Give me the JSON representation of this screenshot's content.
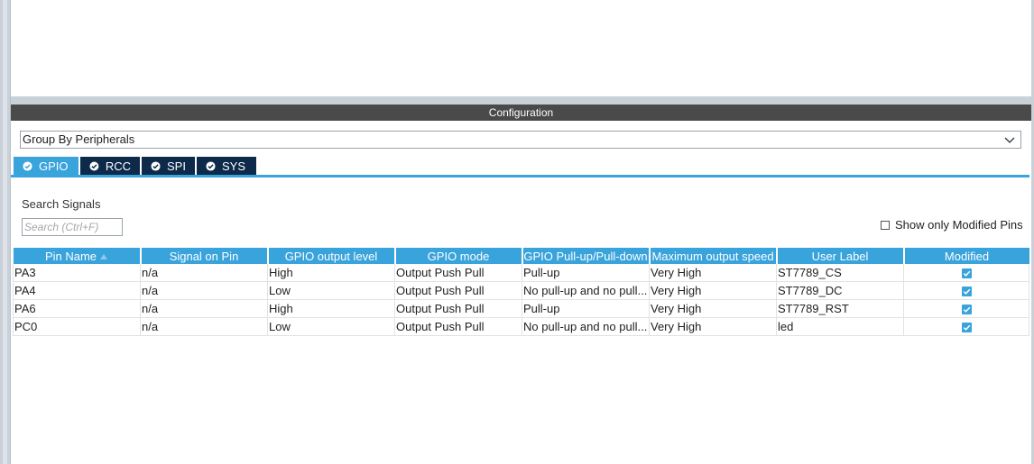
{
  "config_title": "Configuration",
  "group_by": {
    "selected": "Group By Peripherals"
  },
  "tabs": [
    {
      "label": "GPIO",
      "active": true
    },
    {
      "label": "RCC",
      "active": false
    },
    {
      "label": "SPI",
      "active": false
    },
    {
      "label": "SYS",
      "active": false
    }
  ],
  "search": {
    "label": "Search Signals",
    "placeholder": "Search (Ctrl+F)",
    "value": ""
  },
  "show_modified": {
    "label": "Show only Modified Pins",
    "checked": false
  },
  "table": {
    "columns": [
      "Pin Name",
      "Signal on Pin",
      "GPIO output level",
      "GPIO mode",
      "GPIO Pull-up/Pull-down",
      "Maximum output speed",
      "User Label",
      "Modified"
    ],
    "sorted_column": "Pin Name",
    "rows": [
      [
        "PA3",
        "n/a",
        "High",
        "Output Push Pull",
        "Pull-up",
        "Very High",
        "ST7789_CS",
        true
      ],
      [
        "PA4",
        "n/a",
        "Low",
        "Output Push Pull",
        "No pull-up and no pull...",
        "Very High",
        "ST7789_DC",
        true
      ],
      [
        "PA6",
        "n/a",
        "High",
        "Output Push Pull",
        "Pull-up",
        "Very High",
        "ST7789_RST",
        true
      ],
      [
        "PC0",
        "n/a",
        "Low",
        "Output Push Pull",
        "No pull-up and no pull...",
        "Very High",
        "led",
        true
      ]
    ]
  },
  "colors": {
    "accent": "#39a3dc",
    "tab_inactive": "#0d2a4a",
    "header_bar": "#4a4a4a"
  }
}
